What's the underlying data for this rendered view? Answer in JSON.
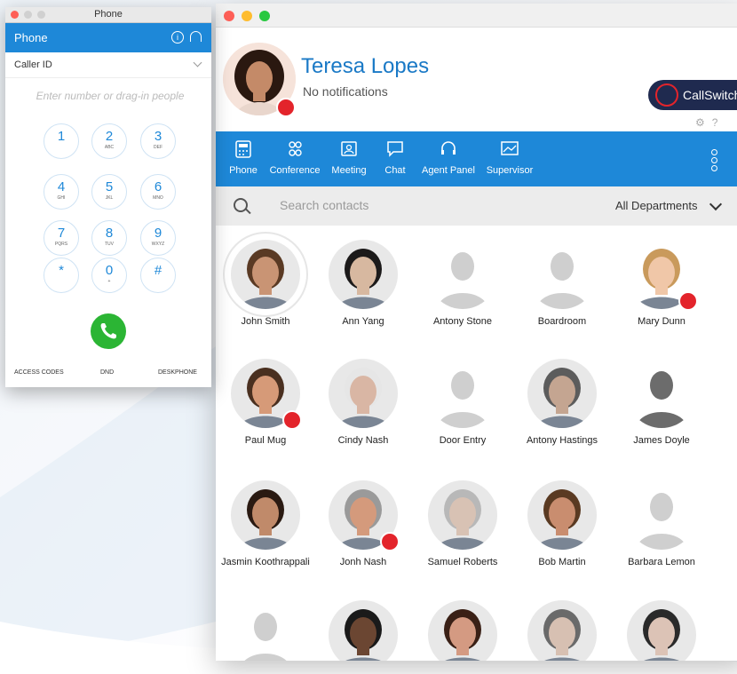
{
  "phone": {
    "window_title": "Phone",
    "header_title": "Phone",
    "caller_id_label": "Caller ID",
    "number_placeholder": "Enter number or drag-in people",
    "keys": [
      {
        "digit": "1",
        "letters": ""
      },
      {
        "digit": "2",
        "letters": "ABC"
      },
      {
        "digit": "3",
        "letters": "DEF"
      },
      {
        "digit": "4",
        "letters": "GHI"
      },
      {
        "digit": "5",
        "letters": "JKL"
      },
      {
        "digit": "6",
        "letters": "MNO"
      },
      {
        "digit": "7",
        "letters": "PQRS"
      },
      {
        "digit": "8",
        "letters": "TUV"
      },
      {
        "digit": "9",
        "letters": "WXYZ"
      },
      {
        "digit": "*",
        "letters": ""
      },
      {
        "digit": "0",
        "letters": "+"
      },
      {
        "digit": "#",
        "letters": ""
      }
    ],
    "footer": {
      "access_codes": "ACCESS CODES",
      "dnd": "DND",
      "deskphone": "DESKPHONE"
    }
  },
  "profile": {
    "name": "Teresa Lopes",
    "status": "No notifications",
    "brand_button": "CallSwitch"
  },
  "toolbar": [
    {
      "label": "Phone",
      "icon": "phone-grid-icon"
    },
    {
      "label": "Conference",
      "icon": "conference-icon"
    },
    {
      "label": "Meeting",
      "icon": "meeting-icon"
    },
    {
      "label": "Chat",
      "icon": "chat-icon"
    },
    {
      "label": "Agent Panel",
      "icon": "headset-icon"
    },
    {
      "label": "Supervisor",
      "icon": "supervisor-icon"
    }
  ],
  "search": {
    "placeholder": "Search contacts",
    "department": "All Departments"
  },
  "contacts": [
    {
      "name": "John Smith",
      "kind": "photo",
      "skin": "#c99474",
      "hair": "#5a3a24",
      "on_call": false,
      "selected": true
    },
    {
      "name": "Ann Yang",
      "kind": "photo",
      "skin": "#d7b8a0",
      "hair": "#1c1a1a",
      "on_call": false,
      "selected": false
    },
    {
      "name": "Antony Stone",
      "kind": "placeholder",
      "on_call": false,
      "selected": false
    },
    {
      "name": "Boardroom",
      "kind": "placeholder",
      "on_call": false,
      "selected": false
    },
    {
      "name": "Mary Dunn",
      "kind": "photo",
      "skin": "#f0c7a8",
      "hair": "#c99a5c",
      "on_call": true,
      "selected": false,
      "white_bg": true
    },
    {
      "name": "Paul Mug",
      "kind": "photo",
      "skin": "#d69a78",
      "hair": "#4a3020",
      "on_call": true,
      "selected": false
    },
    {
      "name": "Cindy Nash",
      "kind": "photo",
      "skin": "#d9b6a4",
      "hair": "#e6e6e6",
      "on_call": false,
      "selected": false
    },
    {
      "name": "Door Entry",
      "kind": "placeholder",
      "on_call": false,
      "selected": false
    },
    {
      "name": "Antony Hastings",
      "kind": "photo",
      "skin": "#c4a591",
      "hair": "#5c5c5c",
      "on_call": false,
      "selected": false
    },
    {
      "name": "James Doyle",
      "kind": "silhouette-dark",
      "on_call": false,
      "selected": false
    },
    {
      "name": "Jasmin Koothrappali",
      "kind": "photo",
      "skin": "#c08a6a",
      "hair": "#2a1a12",
      "on_call": false,
      "selected": false
    },
    {
      "name": "Jonh Nash",
      "kind": "photo",
      "skin": "#d49a7c",
      "hair": "#9a9a9a",
      "on_call": true,
      "selected": false
    },
    {
      "name": "Samuel Roberts",
      "kind": "photo",
      "skin": "#d8c2b4",
      "hair": "#b8b8b8",
      "on_call": false,
      "selected": false
    },
    {
      "name": "Bob Martin",
      "kind": "photo",
      "skin": "#c98d6f",
      "hair": "#5a3a22",
      "on_call": false,
      "selected": false
    },
    {
      "name": "Barbara Lemon",
      "kind": "placeholder",
      "on_call": false,
      "selected": false
    },
    {
      "name": "",
      "kind": "placeholder",
      "on_call": false,
      "selected": false
    },
    {
      "name": "",
      "kind": "photo",
      "skin": "#6b4632",
      "hair": "#1a1a1a",
      "on_call": false,
      "selected": false
    },
    {
      "name": "",
      "kind": "photo",
      "skin": "#d49a82",
      "hair": "#3a2016",
      "on_call": false,
      "selected": false
    },
    {
      "name": "",
      "kind": "photo",
      "skin": "#d7c0b2",
      "hair": "#6a6a6a",
      "on_call": false,
      "selected": false
    },
    {
      "name": "",
      "kind": "photo",
      "skin": "#dcc3b6",
      "hair": "#2a2a2a",
      "on_call": false,
      "selected": false
    }
  ],
  "colors": {
    "accent": "#1e88d8",
    "brand_dark": "#1f2a4f",
    "alert_red": "#e3242b",
    "call_green": "#2bb534"
  }
}
